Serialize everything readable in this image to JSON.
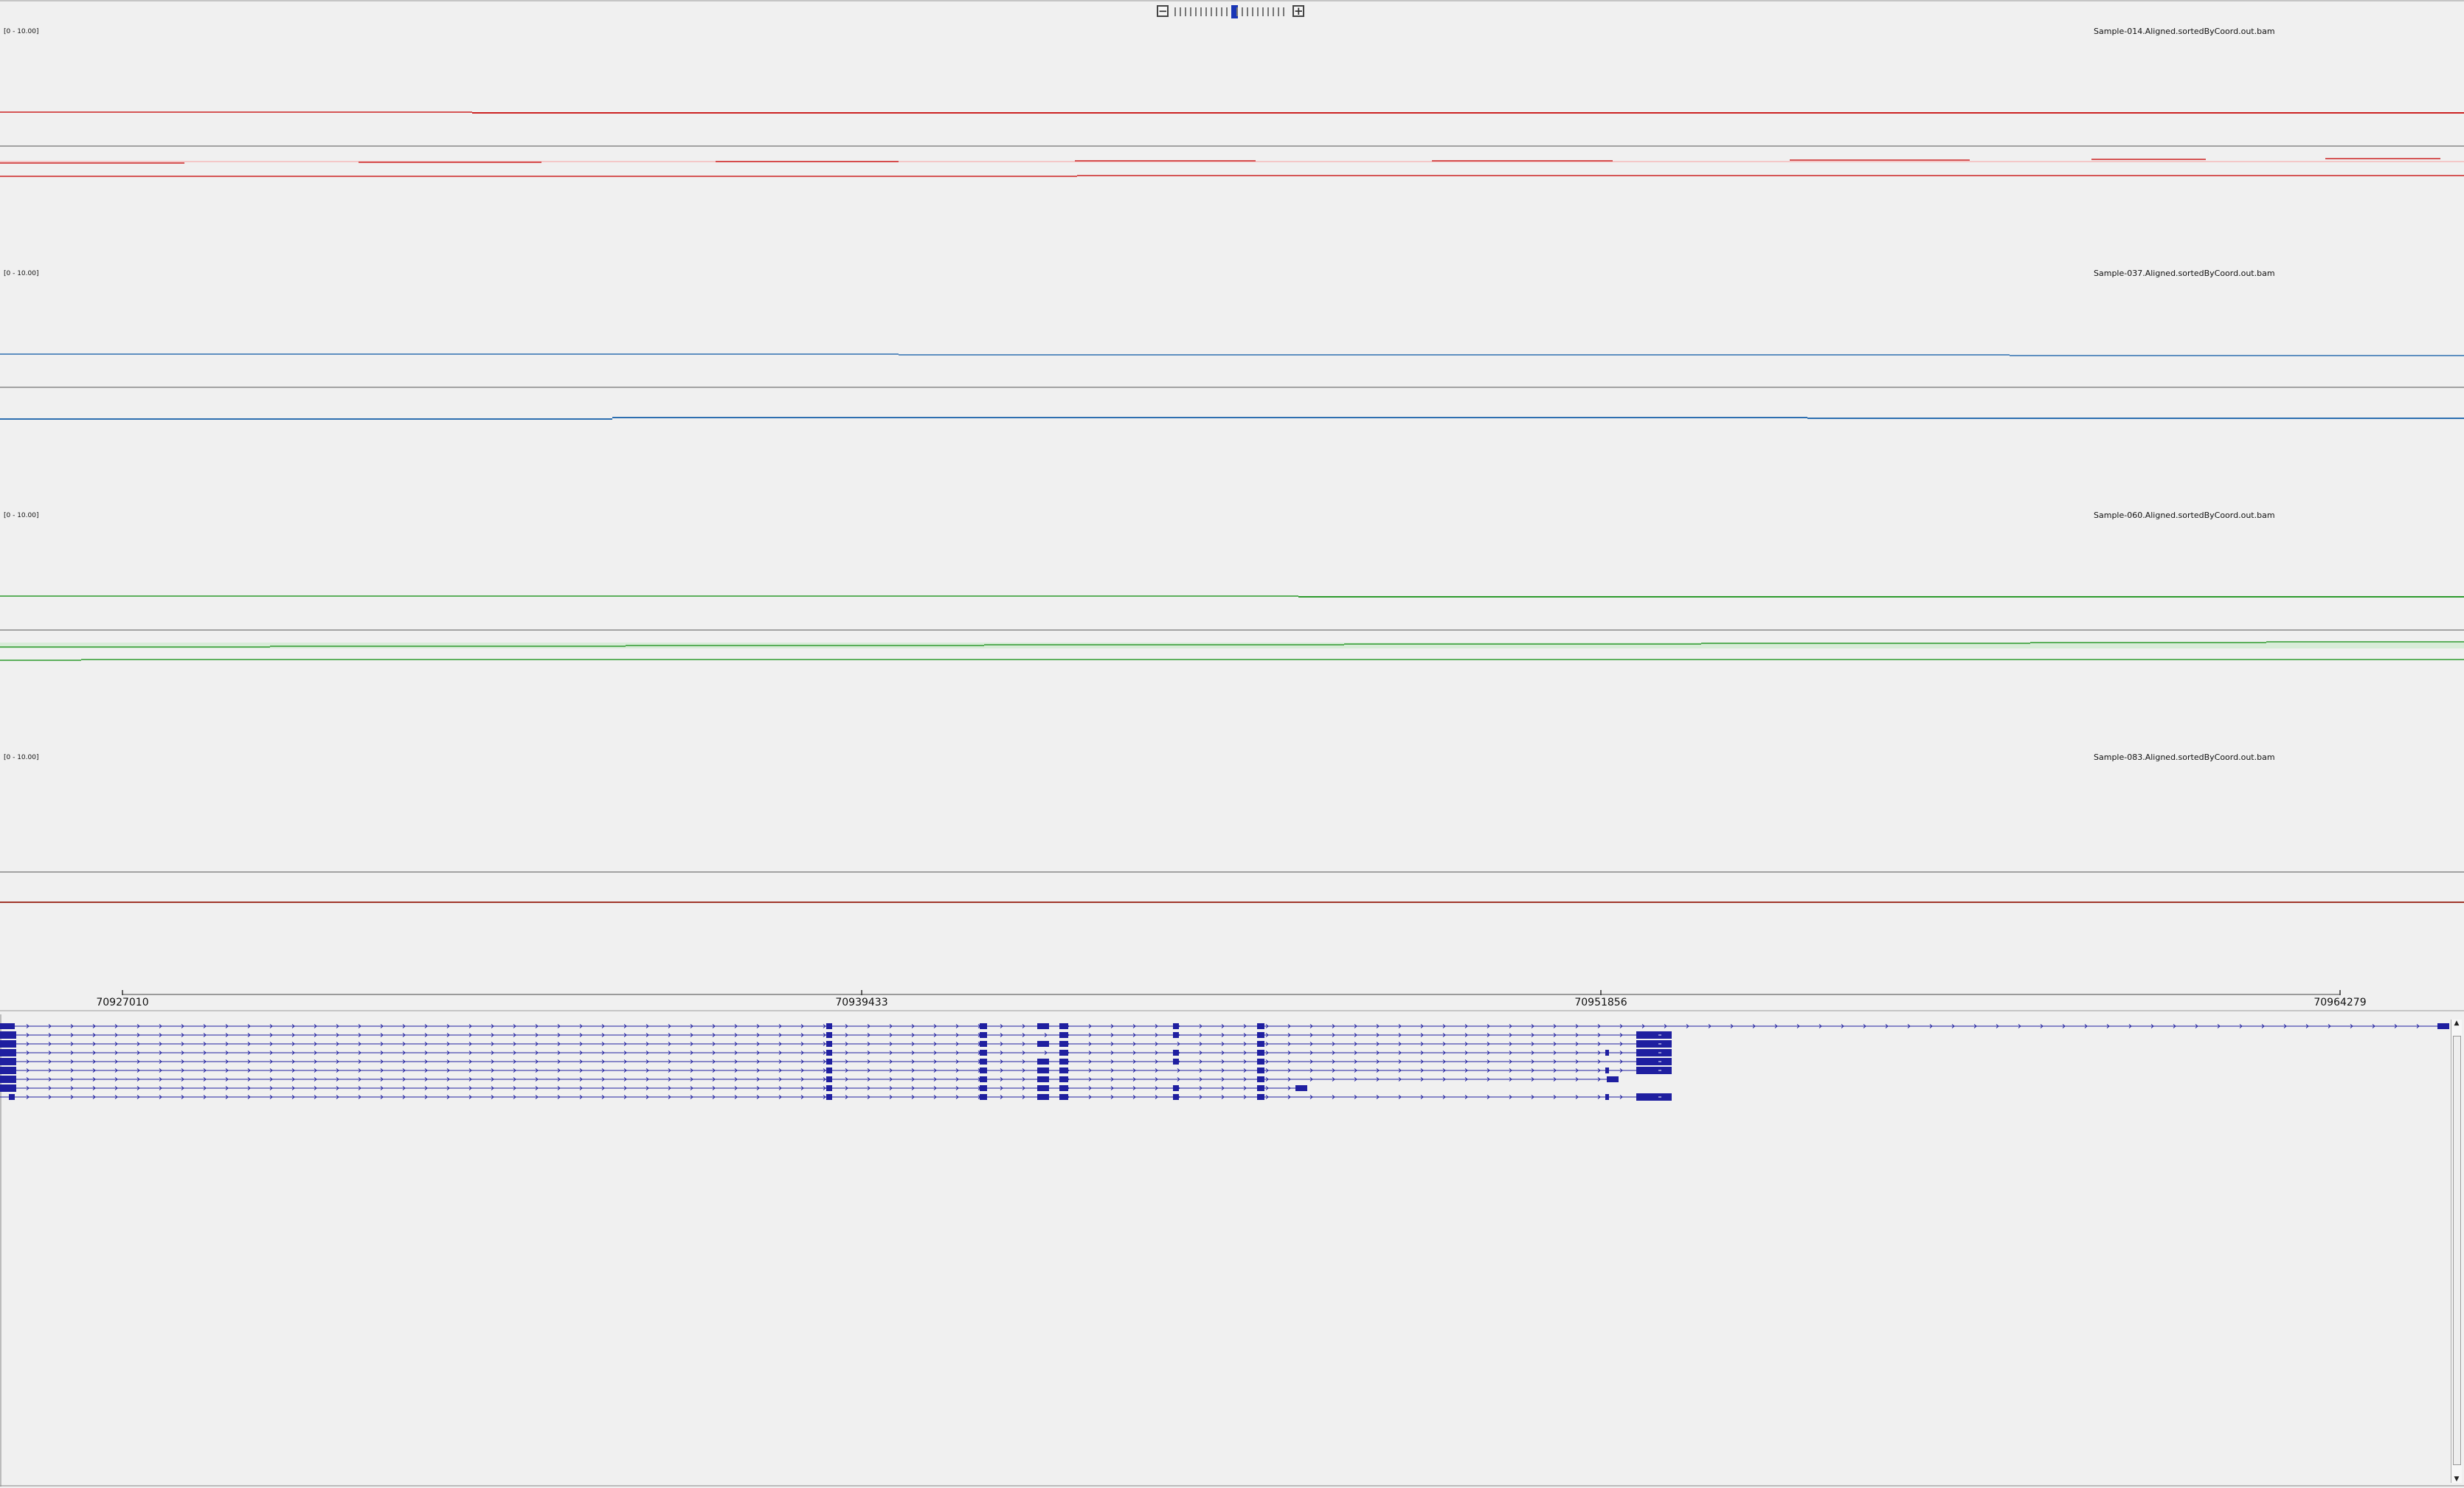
{
  "zoom": {
    "minus_label": "−",
    "plus_label": "+",
    "levels": 22,
    "current_level": 11
  },
  "tracks": [
    {
      "range_label": "[0 - 10.00]",
      "name": "Sample-014.Aligned.sortedByCoord.out.bam",
      "color": "#cc2222"
    },
    {
      "range_label": "[0 - 10.00]",
      "name": "Sample-037.Aligned.sortedByCoord.out.bam",
      "color": "#2e6fb0"
    },
    {
      "range_label": "[0 - 10.00]",
      "name": "Sample-060.Aligned.sortedByCoord.out.bam",
      "color": "#2e9a2e"
    },
    {
      "range_label": "[0 - 10.00]",
      "name": "Sample-083.Aligned.sortedByCoord.out.bam",
      "color": "#a0362a"
    }
  ],
  "ruler": {
    "ticks": [
      "70927010",
      "70939433",
      "70951856",
      "70964279"
    ]
  },
  "annotation": {
    "color": "#1f1fa0"
  }
}
